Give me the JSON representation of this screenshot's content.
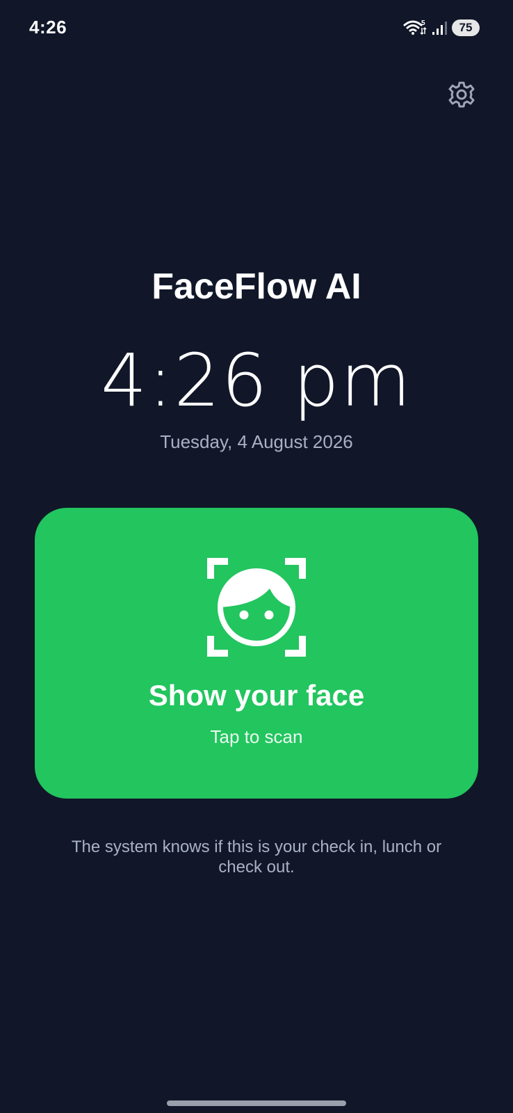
{
  "status_bar": {
    "time": "4:26",
    "wifi_badge": "5",
    "battery": "75",
    "icons": [
      "wifi-icon",
      "signal-icon",
      "battery-icon"
    ]
  },
  "settings": {
    "icon": "gear-icon"
  },
  "app": {
    "title": "FaceFlow AI",
    "clock": "4:26 pm",
    "date": "Tuesday, 4 August 2026"
  },
  "scan_card": {
    "icon": "face-scan-icon",
    "title": "Show your face",
    "subtitle": "Tap to scan"
  },
  "info": {
    "text": "The system knows if this is your check in, lunch or check out."
  },
  "colors": {
    "background": "#111729",
    "accent": "#22c55e",
    "muted_text": "#a9b1c4"
  }
}
